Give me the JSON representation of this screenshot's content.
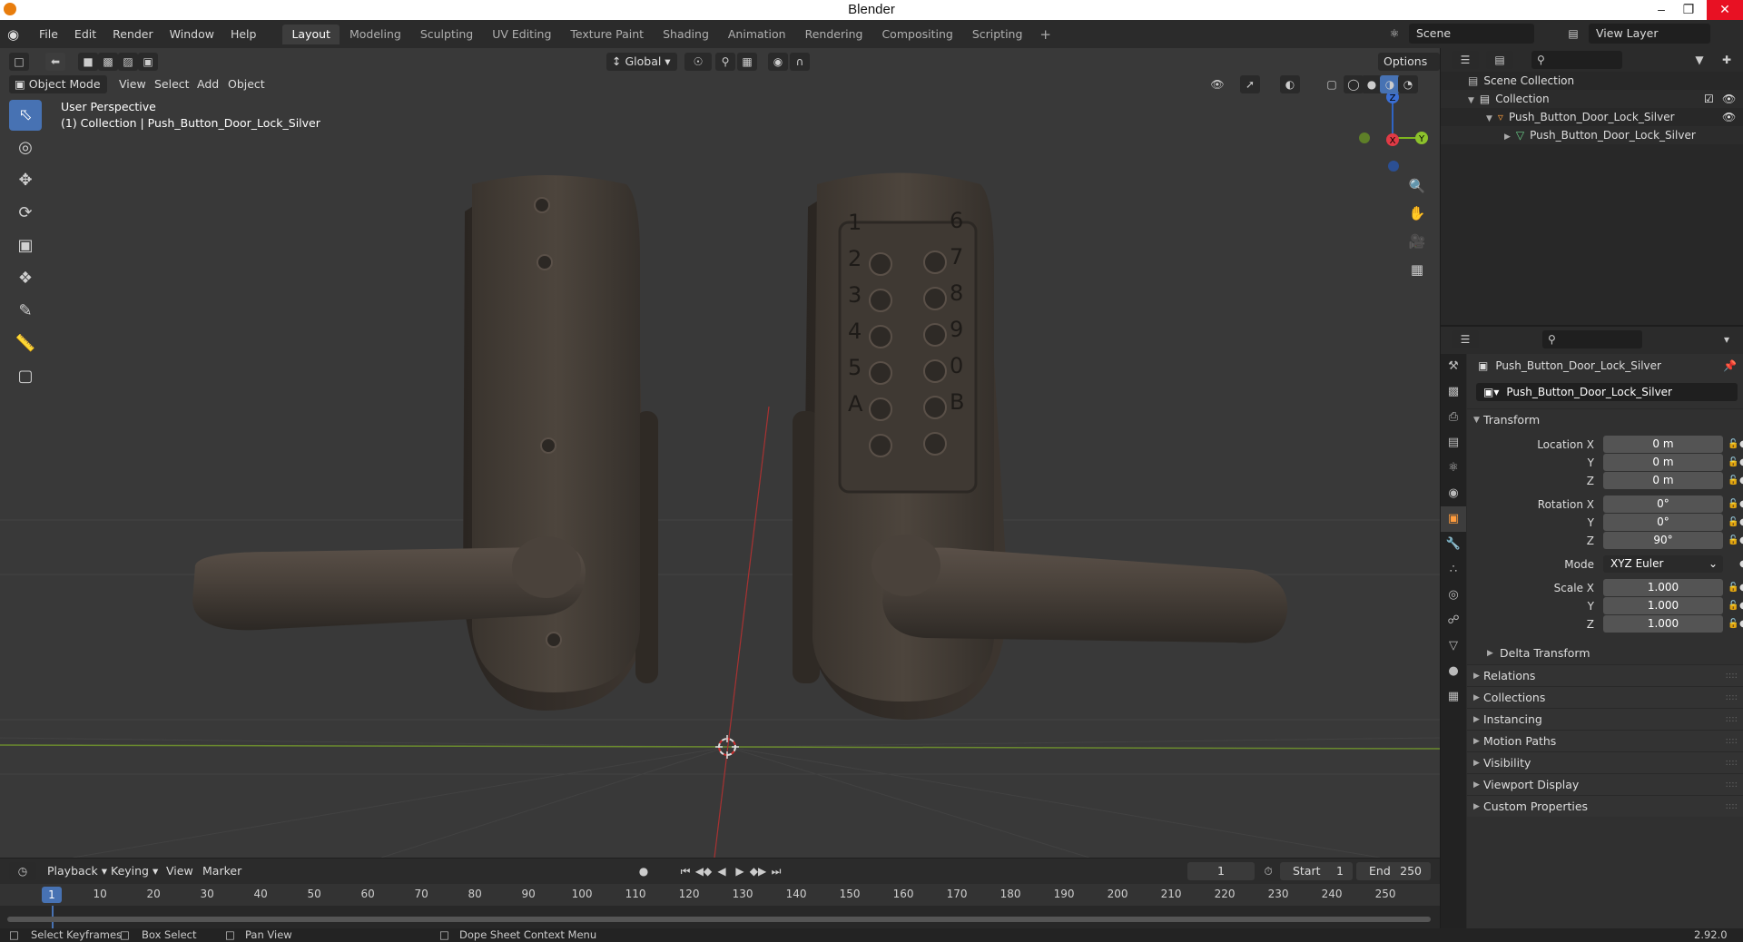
{
  "window": {
    "title": "Blender",
    "version": "2.92.0"
  },
  "menu": [
    "File",
    "Edit",
    "Render",
    "Window",
    "Help"
  ],
  "workspaces": [
    "Layout",
    "Modeling",
    "Sculpting",
    "UV Editing",
    "Texture Paint",
    "Shading",
    "Animation",
    "Rendering",
    "Compositing",
    "Scripting"
  ],
  "scene": {
    "name": "Scene",
    "view_layer": "View Layer"
  },
  "viewport_header": {
    "mode": "Object Mode",
    "menus": [
      "View",
      "Select",
      "Add",
      "Object"
    ],
    "orientation": "Global",
    "options": "Options"
  },
  "viewport": {
    "perspective": "User Perspective",
    "collection_info": "(1) Collection | Push_Button_Door_Lock_Silver",
    "keypad_labels": [
      "1",
      "2",
      "3",
      "4",
      "5",
      "A",
      "6",
      "7",
      "8",
      "9",
      "0",
      "B"
    ]
  },
  "gizmo": {
    "z": "Z",
    "x": "X",
    "y": "Y"
  },
  "outliner": {
    "scene_collection": "Scene Collection",
    "collection": "Collection",
    "object": "Push_Button_Door_Lock_Silver",
    "mesh": "Push_Button_Door_Lock_Silver"
  },
  "properties": {
    "object_name": "Push_Button_Door_Lock_Silver",
    "datablock": "Push_Button_Door_Lock_Silver",
    "transform_label": "Transform",
    "location": {
      "label_x": "Location X",
      "label_y": "Y",
      "label_z": "Z",
      "x": "0 m",
      "y": "0 m",
      "z": "0 m"
    },
    "rotation": {
      "label_x": "Rotation X",
      "label_y": "Y",
      "label_z": "Z",
      "x": "0°",
      "y": "0°",
      "z": "90°"
    },
    "mode_label": "Mode",
    "mode_value": "XYZ Euler",
    "scale": {
      "label_x": "Scale X",
      "label_y": "Y",
      "label_z": "Z",
      "x": "1.000",
      "y": "1.000",
      "z": "1.000"
    },
    "delta_transform": "Delta Transform",
    "panels": [
      "Relations",
      "Collections",
      "Instancing",
      "Motion Paths",
      "Visibility",
      "Viewport Display",
      "Custom Properties"
    ]
  },
  "timeline": {
    "menus": [
      "Playback",
      "Keying",
      "View",
      "Marker"
    ],
    "current_frame": "1",
    "start_label": "Start",
    "start": "1",
    "end_label": "End",
    "end": "250",
    "ticks": [
      "10",
      "20",
      "30",
      "40",
      "50",
      "60",
      "70",
      "80",
      "90",
      "100",
      "110",
      "120",
      "130",
      "140",
      "150",
      "160",
      "170",
      "180",
      "190",
      "200",
      "210",
      "220",
      "230",
      "240",
      "250"
    ]
  },
  "status": {
    "select_keyframes": "Select Keyframes",
    "box_select": "Box Select",
    "pan_view": "Pan View",
    "context_menu": "Dope Sheet Context Menu"
  }
}
